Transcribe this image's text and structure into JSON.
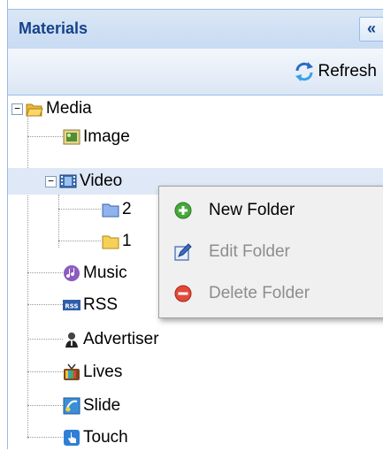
{
  "panel": {
    "title": "Materials",
    "collapse_glyph": "«"
  },
  "toolbar": {
    "refresh_label": "Refresh",
    "refresh_icon": "refresh-icon"
  },
  "tree": {
    "root": {
      "label": "Media",
      "icon": "folder-open-icon",
      "expanded": true
    },
    "items": [
      {
        "label": "Image",
        "icon": "image-icon"
      },
      {
        "label": "Video",
        "icon": "video-icon",
        "expanded": true,
        "selected": true,
        "children": [
          {
            "label": "2",
            "icon": "folder-blue-icon"
          },
          {
            "label": "1",
            "icon": "folder-yellow-icon"
          }
        ]
      },
      {
        "label": "Music",
        "icon": "music-icon"
      },
      {
        "label": "RSS",
        "icon": "rss-icon"
      },
      {
        "label": "Advertiser",
        "icon": "advertiser-icon"
      },
      {
        "label": "Lives",
        "icon": "tv-icon"
      },
      {
        "label": "Slide",
        "icon": "slide-icon"
      },
      {
        "label": "Touch",
        "icon": "touch-icon"
      }
    ]
  },
  "context_menu": {
    "items": [
      {
        "label": "New Folder",
        "icon": "add-icon",
        "enabled": true
      },
      {
        "label": "Edit Folder",
        "icon": "edit-icon",
        "enabled": false
      },
      {
        "label": "Delete Folder",
        "icon": "delete-icon",
        "enabled": false
      }
    ]
  },
  "colors": {
    "header_text": "#15428b",
    "selected_row": "#dfe8f6",
    "disabled_text": "#8d8d8d"
  }
}
